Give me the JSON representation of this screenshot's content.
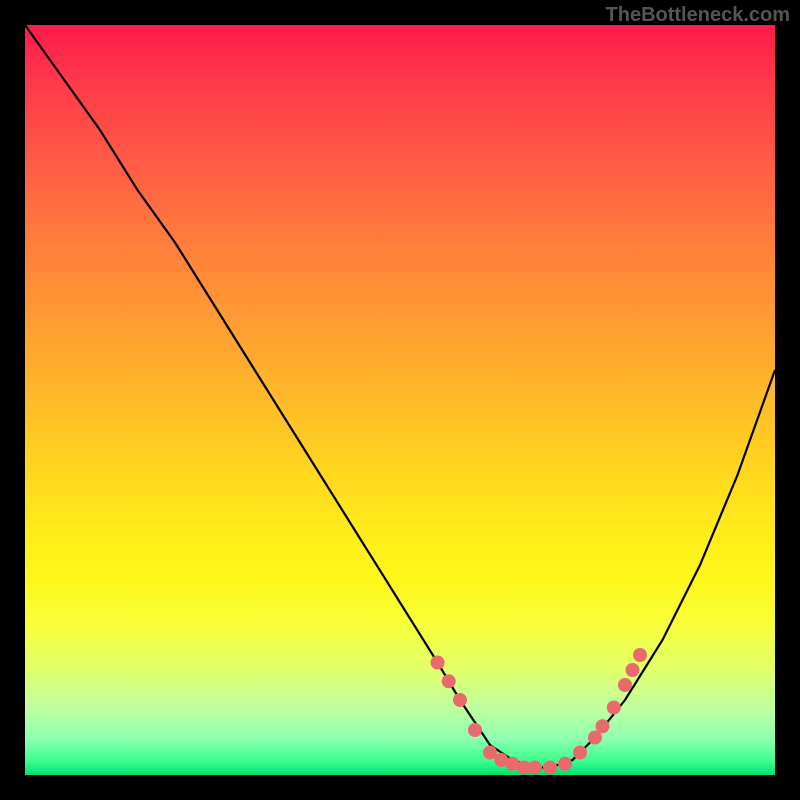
{
  "watermark": "TheBottleneck.com",
  "chart_data": {
    "type": "line",
    "title": "",
    "xlabel": "",
    "ylabel": "",
    "xlim": [
      0,
      100
    ],
    "ylim": [
      0,
      100
    ],
    "series": [
      {
        "name": "curve",
        "x": [
          0,
          5,
          10,
          15,
          20,
          25,
          30,
          35,
          40,
          45,
          50,
          55,
          58,
          60,
          62,
          65,
          68,
          70,
          73,
          76,
          80,
          85,
          90,
          95,
          100
        ],
        "y": [
          100,
          93,
          86,
          78,
          71,
          63,
          55,
          47,
          39,
          31,
          23,
          15,
          10,
          7,
          4,
          2,
          1,
          1,
          2,
          5,
          10,
          18,
          28,
          40,
          54
        ]
      }
    ],
    "markers": [
      {
        "x": 55,
        "y": 15
      },
      {
        "x": 56.5,
        "y": 12.5
      },
      {
        "x": 58,
        "y": 10
      },
      {
        "x": 60,
        "y": 6
      },
      {
        "x": 62,
        "y": 3
      },
      {
        "x": 63.5,
        "y": 2
      },
      {
        "x": 65,
        "y": 1.5
      },
      {
        "x": 66.5,
        "y": 1
      },
      {
        "x": 68,
        "y": 1
      },
      {
        "x": 70,
        "y": 1
      },
      {
        "x": 72,
        "y": 1.5
      },
      {
        "x": 74,
        "y": 3
      },
      {
        "x": 76,
        "y": 5
      },
      {
        "x": 77,
        "y": 6.5
      },
      {
        "x": 78.5,
        "y": 9
      },
      {
        "x": 80,
        "y": 12
      },
      {
        "x": 81,
        "y": 14
      },
      {
        "x": 82,
        "y": 16
      }
    ],
    "marker_color": "#e86a6a",
    "gradient": {
      "top": "#ff1a4a",
      "bottom": "#00e070"
    }
  }
}
